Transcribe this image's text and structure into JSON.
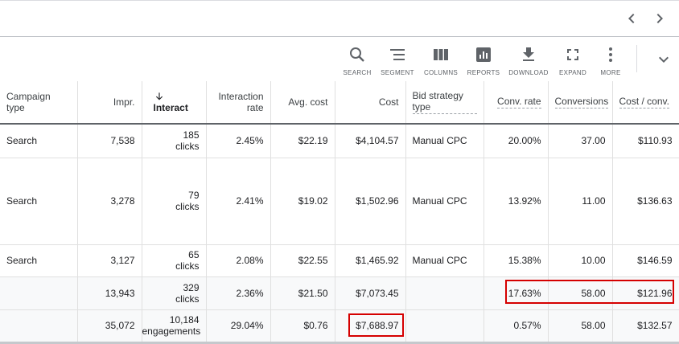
{
  "toolbar": {
    "search": "SEARCH",
    "segment": "SEGMENT",
    "columns": "COLUMNS",
    "reports": "REPORTS",
    "download": "DOWNLOAD",
    "expand": "EXPAND",
    "more": "MORE"
  },
  "icons": {
    "prev": "chevron-left-icon",
    "next": "chevron-right-icon",
    "collapse": "chevron-down-icon",
    "sort": "arrow-down-icon"
  },
  "colors": {
    "highlight": "#d50000",
    "text": "#202124",
    "muted": "#5f6368"
  },
  "headers": {
    "campaign_type": "Campaign type",
    "impr": "Impr.",
    "interactions": "Interact",
    "interaction_rate": "Interaction rate",
    "avg_cost": "Avg. cost",
    "cost": "Cost",
    "bid_strategy": "Bid strategy type",
    "conv_rate": "Conv. rate",
    "conversions": "Conversions",
    "cost_conv": "Cost / conv."
  },
  "rows": [
    {
      "type": "Search",
      "impr": "7,538",
      "inter_n": "185",
      "inter_u": "clicks",
      "rate": "2.45%",
      "avg": "$22.19",
      "cost": "$4,104.57",
      "bid": "Manual CPC",
      "conv_rate": "20.00%",
      "conv": "37.00",
      "cpc": "$110.93"
    },
    {
      "type": "Search",
      "impr": "3,278",
      "inter_n": "79",
      "inter_u": "clicks",
      "rate": "2.41%",
      "avg": "$19.02",
      "cost": "$1,502.96",
      "bid": "Manual CPC",
      "conv_rate": "13.92%",
      "conv": "11.00",
      "cpc": "$136.63"
    },
    {
      "type": "Search",
      "impr": "3,127",
      "inter_n": "65",
      "inter_u": "clicks",
      "rate": "2.08%",
      "avg": "$22.55",
      "cost": "$1,465.92",
      "bid": "Manual CPC",
      "conv_rate": "15.38%",
      "conv": "10.00",
      "cpc": "$146.59"
    }
  ],
  "totals": [
    {
      "type": "",
      "impr": "13,943",
      "inter_n": "329",
      "inter_u": "clicks",
      "rate": "2.36%",
      "avg": "$21.50",
      "cost": "$7,073.45",
      "bid": "",
      "conv_rate": "17.63%",
      "conv": "58.00",
      "cpc": "$121.96"
    },
    {
      "type": "",
      "impr": "35,072",
      "inter_n": "10,184",
      "inter_u": "engagements",
      "rate": "29.04%",
      "avg": "$0.76",
      "cost": "$7,688.97",
      "bid": "",
      "conv_rate": "0.57%",
      "conv": "58.00",
      "cpc": "$132.57"
    }
  ]
}
